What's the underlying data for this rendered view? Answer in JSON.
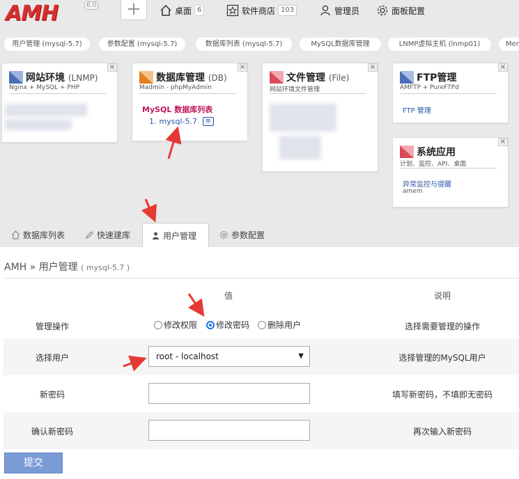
{
  "header": {
    "logo": "AMH",
    "version": "6.0",
    "add_symbol": "+",
    "nav": [
      {
        "label": "桌面",
        "badge": "6",
        "icon": "home-icon"
      },
      {
        "label": "软件商店",
        "badge": "103",
        "icon": "star-icon"
      },
      {
        "label": "管理员",
        "icon": "user-icon"
      },
      {
        "label": "面板配置",
        "icon": "gear-icon"
      }
    ]
  },
  "chips": [
    "用户管理 (mysql-5.7)",
    "参数配置 (mysql-5.7)",
    "数据库列表 (mysql-5.7)",
    "MySQL数据库管理",
    "LNMP虚拟主机 (lnmp01)",
    "Mem"
  ],
  "cards": {
    "lnmp": {
      "title": "网站环境",
      "paren": "(LNMP)",
      "sub": "Nginx + MySQL + PHP"
    },
    "db": {
      "title": "数据库管理",
      "paren": "(DB)",
      "sub": "Madmin - phpMyAdmin",
      "list_title": "MySQL 数据库列表",
      "item_index": "1.",
      "item_label": "mysql-5.7",
      "item_icon": "≡"
    },
    "file": {
      "title": "文件管理",
      "paren": "(File)",
      "sub": "网站环境文件管理"
    },
    "ftp": {
      "title": "FTP管理",
      "sub": "AMFTP + PureFTPd",
      "link": "FTP 管理"
    },
    "sys": {
      "title": "系统应用",
      "sub": "计划、监控、API、桌面",
      "link": "异常监控与提醒",
      "extra": "amem"
    },
    "close": "×"
  },
  "tabs": [
    {
      "label": "数据库列表",
      "icon": "home-icon"
    },
    {
      "label": "快速建库",
      "icon": "pencil-icon"
    },
    {
      "label": "用户管理",
      "icon": "user-icon"
    },
    {
      "label": "参数配置",
      "icon": "gear-icon"
    }
  ],
  "content": {
    "crumb_root": "AMH",
    "crumb_sep": "»",
    "crumb_page": "用户管理",
    "crumb_sub": "( mysql-5.7 )",
    "col_value": "值",
    "col_desc": "说明",
    "rows": {
      "action": {
        "label": "管理操作",
        "desc": "选择需要管理的操作",
        "options": [
          "修改权限",
          "修改密码",
          "删除用户"
        ],
        "selected": "修改密码"
      },
      "user": {
        "label": "选择用户",
        "desc": "选择管理的MySQL用户",
        "value": "root - localhost",
        "caret": "▼"
      },
      "newpw": {
        "label": "新密码",
        "desc": "填写新密码，不填即无密码"
      },
      "confirm": {
        "label": "确认新密码",
        "desc": "再次输入新密码"
      }
    },
    "submit": "提交"
  },
  "colors": {
    "logo": "#d32f2f",
    "link": "#2a56a8",
    "db_list": "#c2185b",
    "arrow": "#e53935",
    "submit": "#7a9bd6"
  }
}
